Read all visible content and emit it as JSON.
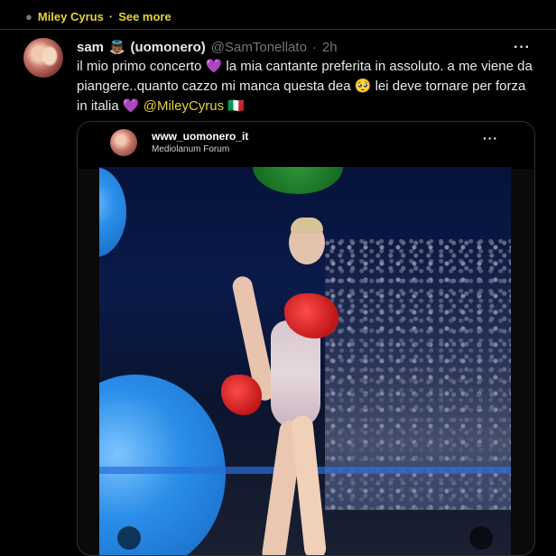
{
  "topic": {
    "label": "Miley Cyrus",
    "separator": "·",
    "see_more": "See more"
  },
  "tweet": {
    "display_name": "sam",
    "name_emoji": "👼🏾",
    "name_suffix": "(uomonero)",
    "handle": "@SamTonellato",
    "separator": "·",
    "time": "2h",
    "more_icon": "more-dots-icon",
    "text": {
      "part1": "il mio primo concerto",
      "heart1": "💜",
      "part2": "la mia cantante preferita in assoluto. a me viene da piangere..quanto cazzo mi manca questa dea",
      "emoji_pleading": "🥺",
      "part3": "lei deve tornare per forza in italia",
      "heart2": "💜",
      "mention": "@MileyCyrus",
      "flag": "🇮🇹"
    }
  },
  "media": {
    "video_user": "www_uomonero_it",
    "video_location": "Mediolanum Forum",
    "more_icon": "more-dots-icon"
  },
  "colors": {
    "accent": "#e5d23a",
    "background": "#000000",
    "muted": "#71767b",
    "text": "#e7e9ea"
  }
}
